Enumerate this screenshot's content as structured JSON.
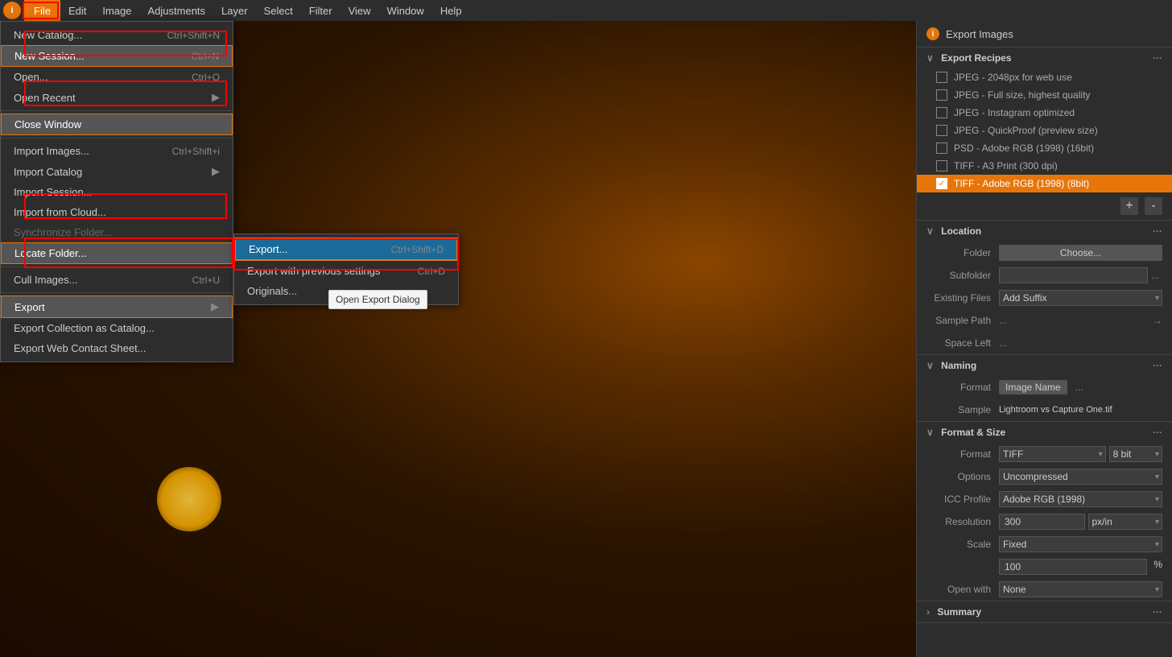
{
  "app": {
    "title": "Export Images",
    "logo_text": "i"
  },
  "menubar": {
    "items": [
      "File",
      "Edit",
      "Image",
      "Adjustments",
      "Layer",
      "Select",
      "Filter",
      "View",
      "Window",
      "Help"
    ]
  },
  "file_menu": {
    "items": [
      {
        "label": "New Catalog...",
        "shortcut": "Ctrl+Shift+N",
        "disabled": false,
        "has_arrow": false,
        "id": "new-catalog"
      },
      {
        "label": "New Session...",
        "shortcut": "Ctrl+N",
        "disabled": false,
        "has_arrow": false,
        "id": "new-session",
        "highlighted": true
      },
      {
        "label": "Open...",
        "shortcut": "Ctrl+O",
        "disabled": false,
        "has_arrow": false,
        "id": "open"
      },
      {
        "label": "Open Recent",
        "shortcut": "",
        "disabled": false,
        "has_arrow": true,
        "id": "open-recent"
      },
      {
        "label": "separator",
        "id": "sep1"
      },
      {
        "label": "Close Window",
        "shortcut": "",
        "disabled": false,
        "has_arrow": false,
        "id": "close-window",
        "highlighted": true
      },
      {
        "label": "separator",
        "id": "sep2"
      },
      {
        "label": "Import Images...",
        "shortcut": "Ctrl+Shift+i",
        "disabled": false,
        "has_arrow": false,
        "id": "import-images"
      },
      {
        "label": "Import Catalog",
        "shortcut": "",
        "disabled": false,
        "has_arrow": true,
        "id": "import-catalog"
      },
      {
        "label": "Import Session...",
        "shortcut": "",
        "disabled": false,
        "has_arrow": false,
        "id": "import-session"
      },
      {
        "label": "Import from Cloud...",
        "shortcut": "",
        "disabled": false,
        "has_arrow": false,
        "id": "import-cloud"
      },
      {
        "label": "Synchronize Folder...",
        "shortcut": "",
        "disabled": true,
        "has_arrow": false,
        "id": "sync-folder"
      },
      {
        "label": "Locate Folder...",
        "shortcut": "",
        "disabled": false,
        "has_arrow": false,
        "id": "locate-folder",
        "highlighted": true
      },
      {
        "label": "separator",
        "id": "sep3"
      },
      {
        "label": "Cull Images...",
        "shortcut": "Ctrl+U",
        "disabled": false,
        "has_arrow": false,
        "id": "cull-images"
      },
      {
        "label": "separator",
        "id": "sep4"
      },
      {
        "label": "Export",
        "shortcut": "",
        "disabled": false,
        "has_arrow": true,
        "id": "export",
        "active": true
      },
      {
        "label": "Export Collection as Catalog...",
        "shortcut": "",
        "disabled": false,
        "has_arrow": false,
        "id": "export-collection"
      },
      {
        "label": "Export Web Contact Sheet...",
        "shortcut": "",
        "disabled": false,
        "has_arrow": false,
        "id": "export-web"
      }
    ]
  },
  "export_submenu": {
    "items": [
      {
        "label": "Export...",
        "shortcut": "Ctrl+Shift+D",
        "selected": true,
        "id": "export-dialog"
      },
      {
        "label": "Export with previous settings",
        "shortcut": "Ctrl+D",
        "selected": false,
        "id": "export-prev"
      },
      {
        "label": "Originals...",
        "shortcut": "",
        "selected": false,
        "id": "export-originals"
      }
    ],
    "tooltip": "Open Export Dialog"
  },
  "right_panel": {
    "header_title": "Export Images",
    "export_recipes": {
      "title": "Export Recipes",
      "items": [
        {
          "label": "JPEG - 2048px for web use",
          "active": false
        },
        {
          "label": "JPEG - Full size, highest quality",
          "active": false
        },
        {
          "label": "JPEG - Instagram optimized",
          "active": false
        },
        {
          "label": "JPEG - QuickProof (preview size)",
          "active": false
        },
        {
          "label": "PSD - Adobe RGB (1998) (16bit)",
          "active": false
        },
        {
          "label": "TIFF - A3 Print (300 dpi)",
          "active": false
        },
        {
          "label": "TIFF - Adobe RGB (1998) (8bit)",
          "active": true
        }
      ],
      "add_label": "+",
      "remove_label": "-"
    },
    "location": {
      "title": "Location",
      "folder_label": "Folder",
      "folder_btn": "Choose...",
      "subfolder_label": "Subfolder",
      "subfolder_dots": "...",
      "existing_files_label": "Existing Files",
      "existing_files_value": "Add Suffix",
      "sample_path_label": "Sample Path",
      "sample_path_value": "...",
      "space_left_label": "Space Left",
      "space_left_value": "..."
    },
    "naming": {
      "title": "Naming",
      "format_label": "Format",
      "format_badge": "Image Name",
      "format_dots": "...",
      "sample_label": "Sample",
      "sample_value": "Lightroom vs Capture One.tif"
    },
    "format_size": {
      "title": "Format & Size",
      "format_label": "Format",
      "format_value": "TIFF",
      "bit_label": "8 bit",
      "options_label": "Options",
      "options_value": "Uncompressed",
      "icc_label": "ICC Profile",
      "icc_value": "Adobe RGB (1998)",
      "resolution_label": "Resolution",
      "resolution_value": "300",
      "resolution_unit": "px/in",
      "scale_label": "Scale",
      "scale_value": "Fixed",
      "scale_pct": "100",
      "scale_unit": "%",
      "open_with_label": "Open with",
      "open_with_value": "None"
    },
    "summary": {
      "title": "Summary"
    }
  }
}
